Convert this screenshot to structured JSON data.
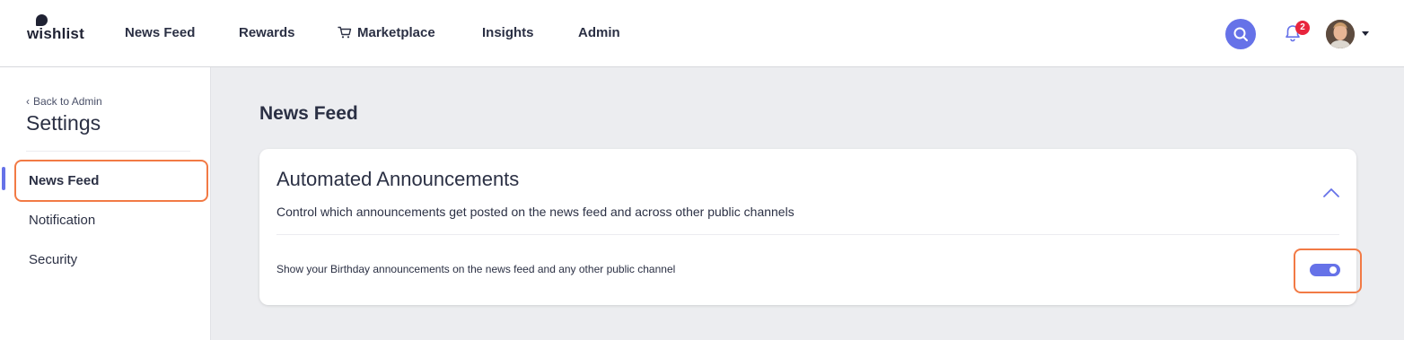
{
  "brand": {
    "name": "wishlist"
  },
  "nav": {
    "items": [
      {
        "label": "News Feed"
      },
      {
        "label": "Rewards"
      },
      {
        "label": "Marketplace",
        "icon": "cart-icon"
      },
      {
        "label": "Insights"
      },
      {
        "label": "Admin"
      }
    ]
  },
  "header": {
    "notification_count": "2",
    "accent_color": "#6672e8",
    "badge_color": "#e8253d"
  },
  "sidebar": {
    "back_label": "Back to Admin",
    "title": "Settings",
    "items": [
      {
        "label": "News Feed",
        "active": true
      },
      {
        "label": "Notification"
      },
      {
        "label": "Security"
      }
    ]
  },
  "main": {
    "page_title": "News Feed",
    "card": {
      "title": "Automated Announcements",
      "description": "Control which announcements get posted on the news feed and across other public channels",
      "setting_label": "Show your Birthday announcements on the news feed and any other public channel",
      "toggle_on": true
    }
  },
  "highlight_color": "#f27a45"
}
